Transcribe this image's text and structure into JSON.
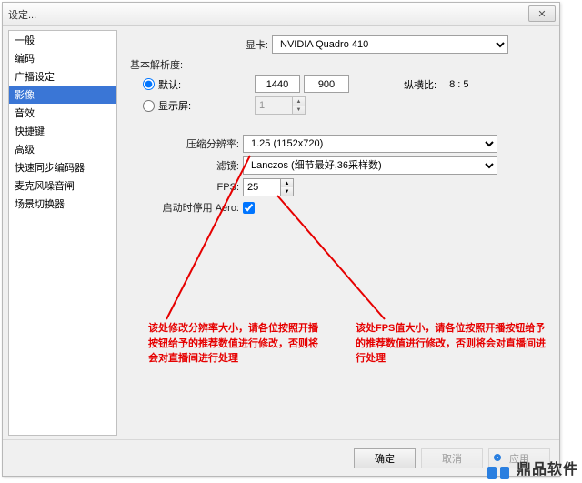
{
  "window": {
    "title": "设定...",
    "close": "✕"
  },
  "sidebar": {
    "items": [
      "一般",
      "编码",
      "广播设定",
      "影像",
      "音效",
      "快捷键",
      "高级",
      "快速同步编码器",
      "麦克风噪音闸",
      "场景切换器"
    ],
    "selected_index": 3
  },
  "gpu": {
    "label": "显卡:",
    "value": "NVIDIA Quadro 410"
  },
  "resolution": {
    "title": "基本解析度:",
    "default_label": "默认:",
    "width": "1440",
    "height": "900",
    "aspect_label": "纵横比:",
    "aspect_value": "8 : 5",
    "monitor_label": "显示屏:",
    "monitor_value": "1"
  },
  "downscale": {
    "label": "压缩分辨率:",
    "value": "1.25   (1152x720)"
  },
  "filter": {
    "label": "滤镜:",
    "value": "Lanczos (细节最好,36采样数)"
  },
  "fps": {
    "label": "FPS:",
    "value": "25"
  },
  "aero": {
    "label": "启动时停用 Aero:",
    "checked": true
  },
  "annotations": {
    "left": "该处修改分辨率大小，请各位按照开播按钮给予的推荐数值进行修改，否则将会对直播间进行处理",
    "right": "该处FPS值大小，请各位按照开播按钮给予的推荐数值进行修改，否则将会对直播间进行处理"
  },
  "buttons": {
    "ok": "确定",
    "cancel": "取消",
    "apply": "应用"
  },
  "watermark": "鼎品软件"
}
